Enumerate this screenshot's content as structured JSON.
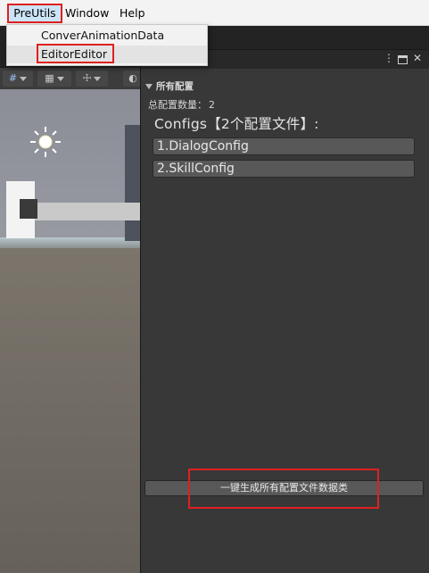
{
  "menubar": {
    "items": [
      {
        "label": "PreUtils"
      },
      {
        "label": "Window"
      },
      {
        "label": "Help"
      }
    ]
  },
  "dropdown": {
    "items": [
      {
        "label": "ConverAnimationData"
      },
      {
        "label": "EditorEditor"
      }
    ]
  },
  "editor": {
    "foldout_label": "所有配置",
    "count_label": "总配置数量：",
    "count_value": "2",
    "configs_header": "Configs【2个配置文件】:",
    "configs": [
      {
        "label": "1.DialogConfig"
      },
      {
        "label": "2.SkillConfig"
      }
    ],
    "generate_button": "一键生成所有配置文件数据类"
  },
  "colors": {
    "highlight": "#e02020",
    "editor_bg": "#383838",
    "button_bg": "#585858"
  }
}
